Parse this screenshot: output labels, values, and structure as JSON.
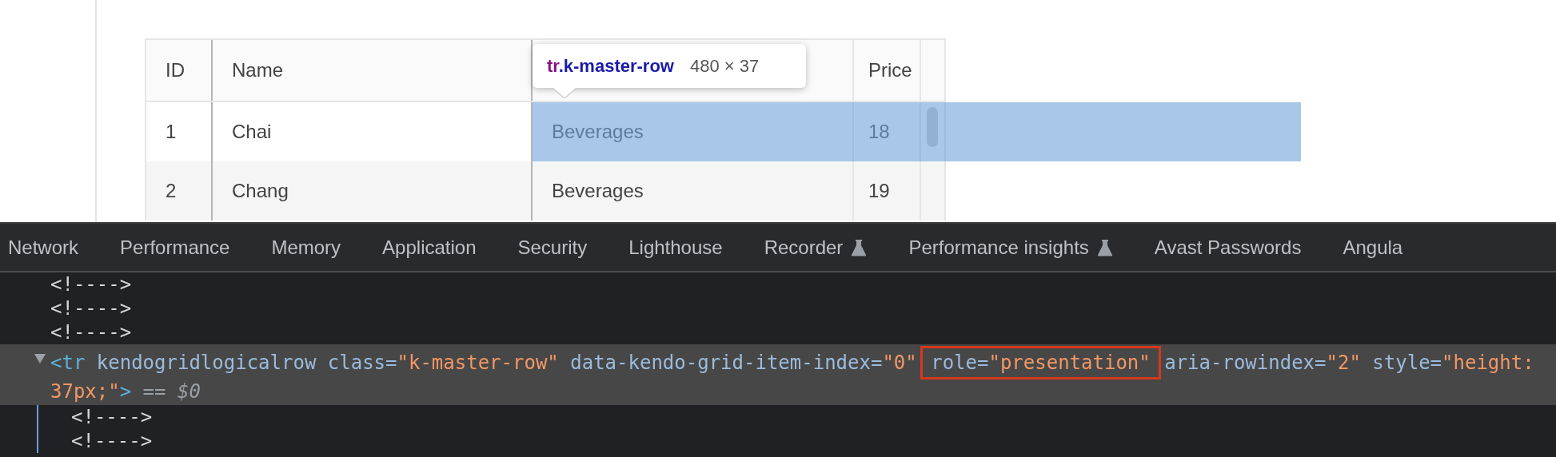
{
  "grid": {
    "columns": [
      {
        "label": "ID"
      },
      {
        "label": "Name"
      },
      {},
      {
        "label": "Price"
      }
    ],
    "rows": [
      {
        "cells": [
          "1",
          "Chai",
          "Beverages",
          "18"
        ],
        "inspected": true
      },
      {
        "cells": [
          "2",
          "Chang",
          "Beverages",
          "19"
        ],
        "inspected": false
      }
    ]
  },
  "tooltip": {
    "tag": "tr",
    "class_name": ".k-master-row",
    "size": "480 × 37"
  },
  "devtools": {
    "tabs": [
      {
        "label": "Network",
        "experimental": false
      },
      {
        "label": "Performance",
        "experimental": false
      },
      {
        "label": "Memory",
        "experimental": false
      },
      {
        "label": "Application",
        "experimental": false
      },
      {
        "label": "Security",
        "experimental": false
      },
      {
        "label": "Lighthouse",
        "experimental": false
      },
      {
        "label": "Recorder",
        "experimental": true
      },
      {
        "label": "Performance insights",
        "experimental": true
      },
      {
        "label": "Avast Passwords",
        "experimental": false
      },
      {
        "label": "Angula",
        "experimental": false
      }
    ],
    "nodes": [
      {
        "kind": "comment",
        "text": "<!---->"
      },
      {
        "kind": "comment",
        "text": "<!---->"
      },
      {
        "kind": "comment",
        "text": "<!---->"
      },
      {
        "kind": "element",
        "expanded": true,
        "selected": true,
        "open": "<tr",
        "attributes": [
          {
            "name": "kendogridlogicalrow",
            "boxed": false
          },
          {
            "name": "class=",
            "value_lines": [
              "\"k-master-row\""
            ],
            "boxed": false
          },
          {
            "name": "data-kendo-grid-item-index=",
            "value_lines": [
              "\"0\""
            ],
            "boxed": false
          },
          {
            "name": "role=",
            "value_lines": [
              "\"presentation\""
            ],
            "boxed": true
          },
          {
            "name": "aria-rowindex=",
            "value_lines": [
              "\"2\""
            ],
            "boxed": false
          },
          {
            "name": "style=",
            "value_lines": [
              "\"height:",
              "37px;\""
            ],
            "boxed": false
          }
        ],
        "close": ">",
        "console_ref": "== *$0*",
        "children": [
          {
            "kind": "comment",
            "text": "<!---->"
          },
          {
            "kind": "comment",
            "text": "<!---->"
          }
        ]
      }
    ]
  }
}
